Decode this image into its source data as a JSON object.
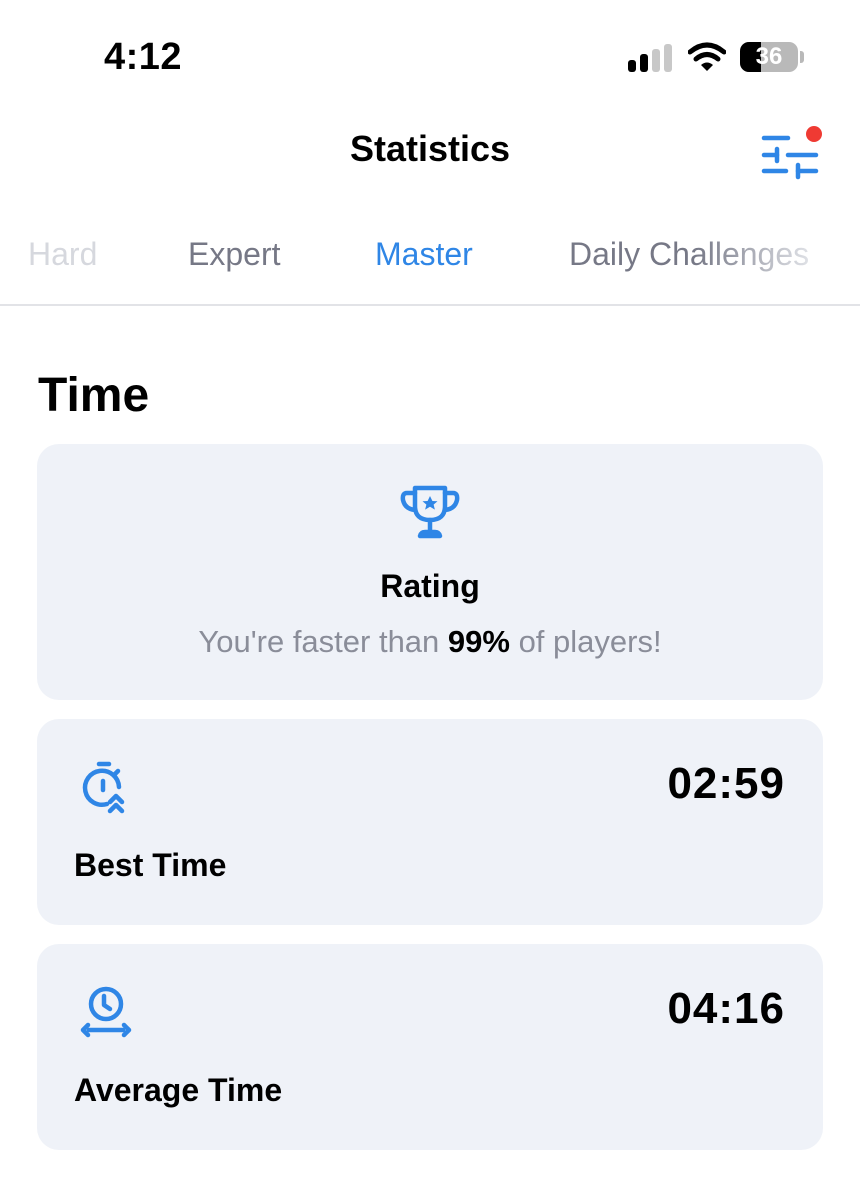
{
  "status_bar": {
    "time": "4:12",
    "signal_bars_active": 2,
    "signal_bars_total": 4,
    "battery_percent": 36,
    "battery_label": "36"
  },
  "header": {
    "title": "Statistics",
    "filter_icon": "sliders-icon",
    "has_notification": true
  },
  "tabs": [
    {
      "label": "Hard",
      "active": false
    },
    {
      "label": "Expert",
      "active": false
    },
    {
      "label": "Master",
      "active": true
    },
    {
      "label": "Daily Challenges",
      "active": false
    }
  ],
  "section": {
    "title": "Time"
  },
  "rating": {
    "icon": "trophy-icon",
    "title": "Rating",
    "text_before": "You're faster than ",
    "percent": "99%",
    "text_after": " of players!"
  },
  "stats": [
    {
      "icon": "stopwatch-up-icon",
      "label": "Best Time",
      "value": "02:59"
    },
    {
      "icon": "clock-range-icon",
      "label": "Average Time",
      "value": "04:16"
    }
  ],
  "colors": {
    "accent": "#2f86e6",
    "notification": "#ef3a33",
    "card_bg": "#eff2f8",
    "muted_text": "#8a8d99"
  }
}
